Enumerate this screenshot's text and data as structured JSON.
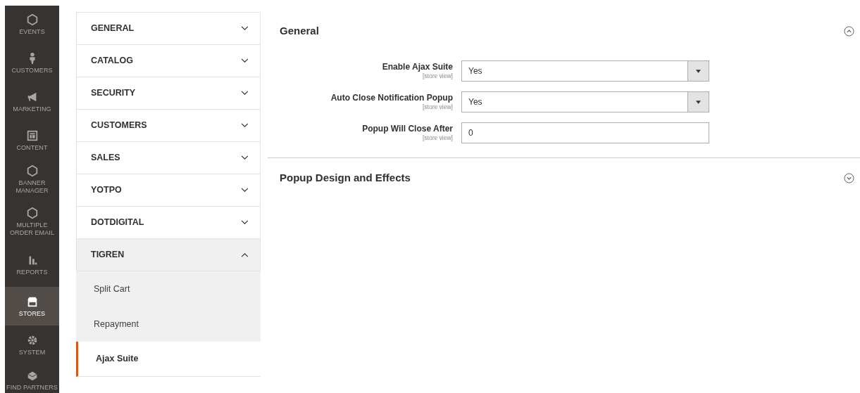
{
  "admin_nav": [
    {
      "label": "EVENTS",
      "selected": false
    },
    {
      "label": "CUSTOMERS",
      "selected": false
    },
    {
      "label": "MARKETING",
      "selected": false
    },
    {
      "label": "CONTENT",
      "selected": false
    },
    {
      "label": "BANNER MANAGER",
      "selected": false
    },
    {
      "label": "MULTIPLE ORDER EMAIL",
      "selected": false
    },
    {
      "label": "REPORTS",
      "selected": false
    },
    {
      "label": "STORES",
      "selected": true
    },
    {
      "label": "SYSTEM",
      "selected": false
    },
    {
      "label": "FIND PARTNERS",
      "selected": false
    }
  ],
  "config_tabs": [
    {
      "label": "GENERAL",
      "expanded": false
    },
    {
      "label": "CATALOG",
      "expanded": false
    },
    {
      "label": "SECURITY",
      "expanded": false
    },
    {
      "label": "CUSTOMERS",
      "expanded": false
    },
    {
      "label": "SALES",
      "expanded": false
    },
    {
      "label": "YOTPO",
      "expanded": false
    },
    {
      "label": "DOTDIGITAL",
      "expanded": false
    },
    {
      "label": "TIGREN",
      "expanded": true,
      "children": [
        {
          "label": "Split Cart",
          "selected": false
        },
        {
          "label": "Repayment",
          "selected": false
        },
        {
          "label": "Ajax Suite",
          "selected": true
        }
      ]
    }
  ],
  "sections": [
    {
      "title": "General",
      "expanded": true,
      "fields": [
        {
          "kind": "select",
          "label": "Enable Ajax Suite",
          "scope": "[store view]",
          "value": "Yes"
        },
        {
          "kind": "select",
          "label": "Auto Close Notification Popup",
          "scope": "[store view]",
          "value": "Yes"
        },
        {
          "kind": "text",
          "label": "Popup Will Close After",
          "scope": "[store view]",
          "value": "0"
        }
      ]
    },
    {
      "title": "Popup Design and Effects",
      "expanded": false
    }
  ]
}
